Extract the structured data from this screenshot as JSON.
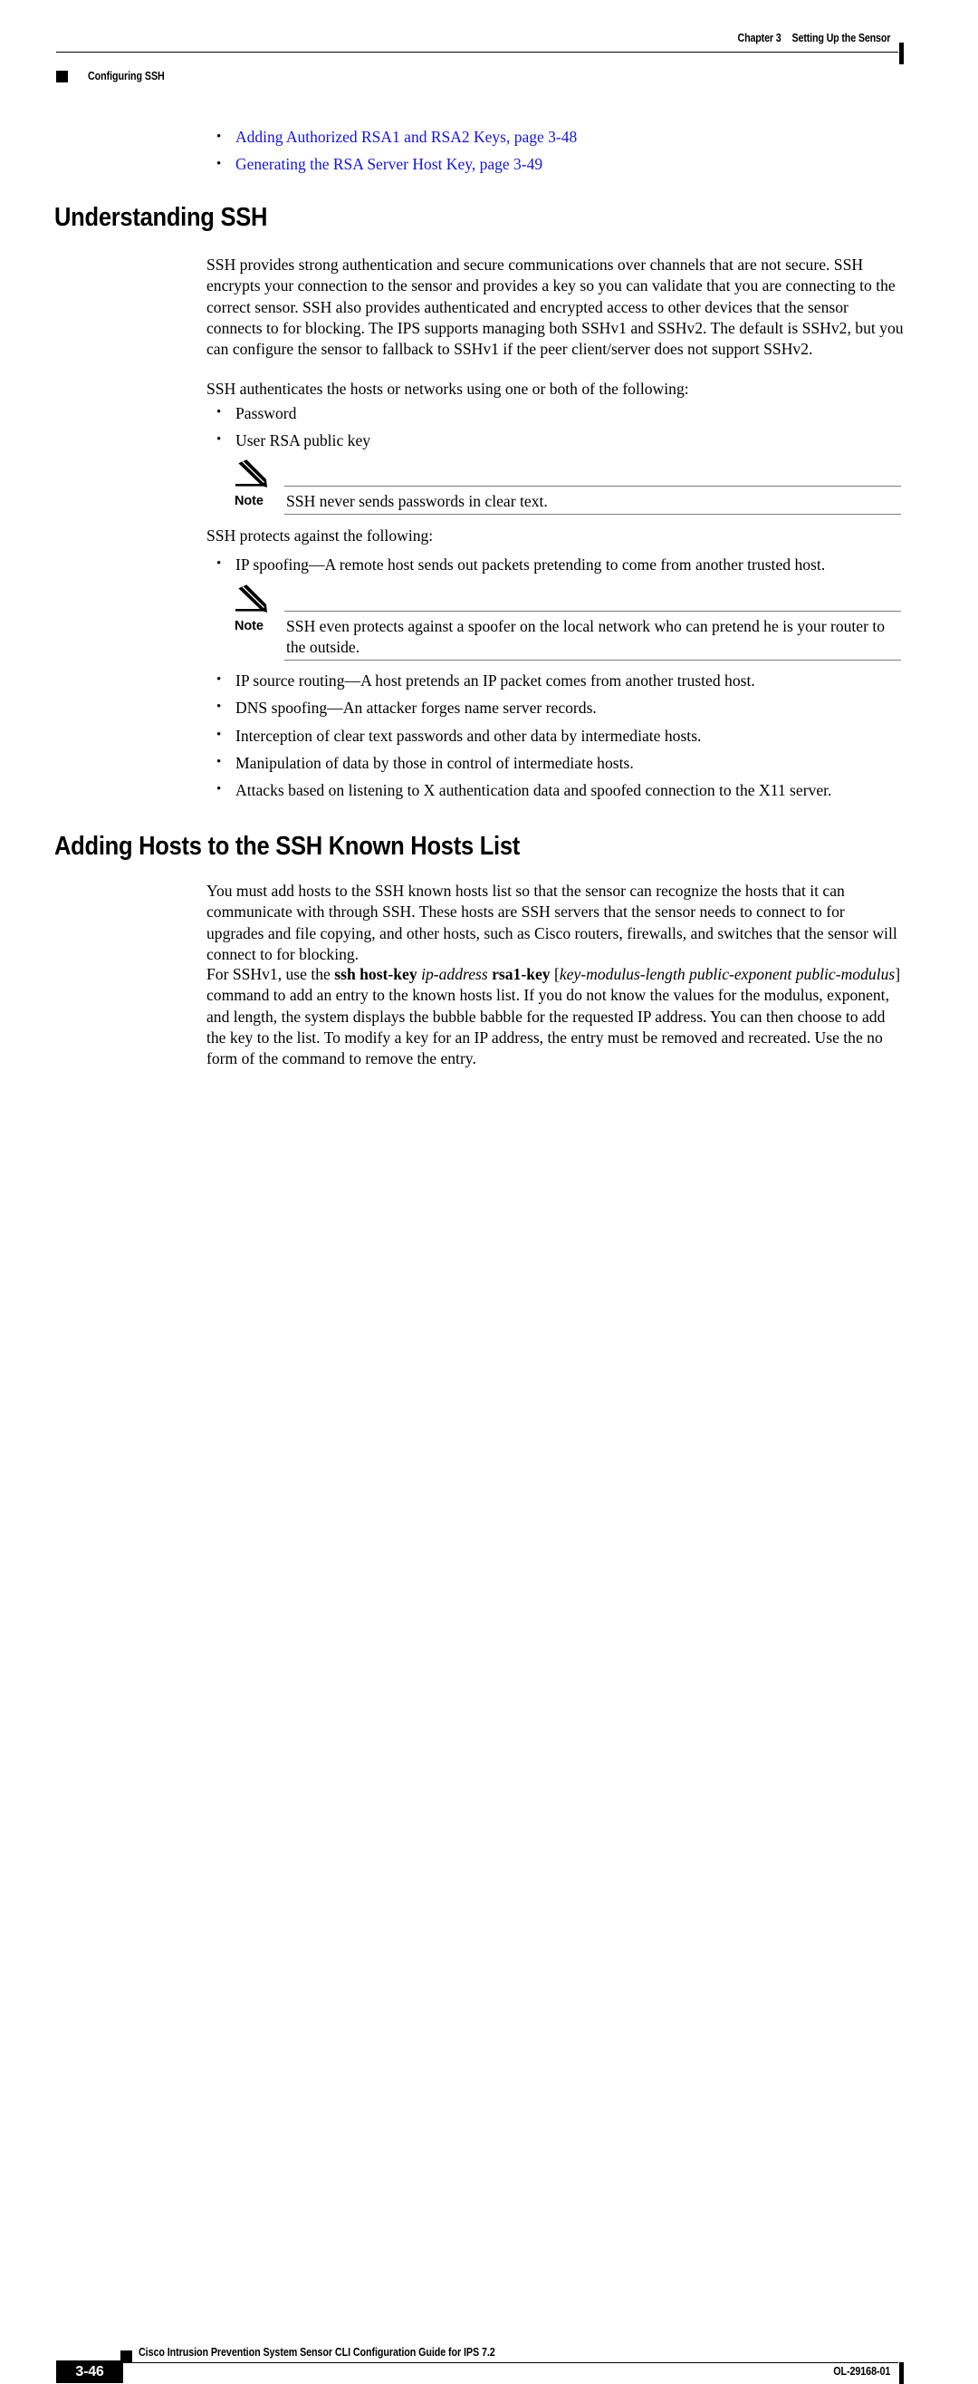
{
  "header": {
    "chapter_label": "Chapter 3",
    "chapter_title": "Setting Up the Sensor",
    "running_head": "Configuring SSH"
  },
  "crossrefs": [
    {
      "bullet": "•",
      "text": "Adding Authorized RSA1 and RSA2 Keys, page 3-48"
    },
    {
      "bullet": "•",
      "text": "Generating the RSA Server Host Key, page 3-49"
    }
  ],
  "sections": {
    "understanding_ssh": {
      "title": "Understanding SSH",
      "paragraph_1": "SSH provides strong authentication and secure communications over channels that are not secure. SSH encrypts your connection to the sensor and provides a key so you can validate that you are connecting to the correct sensor. SSH also provides authenticated and encrypted access to other devices that the sensor connects to for blocking. The IPS supports managing both SSHv1 and SSHv2. The default is SSHv2, but you can configure the sensor to fallback to SSHv1 if the peer client/server does not support SSHv2.",
      "paragraph_2": "SSH authenticates the hosts or networks using one or both of the following:",
      "auth_methods": [
        {
          "bullet": "•",
          "text": "Password"
        },
        {
          "bullet": "•",
          "text": "User RSA public key"
        }
      ],
      "note_1": {
        "icon": "pencil-note-icon",
        "label": "Note",
        "text": "SSH never sends passwords in clear text."
      },
      "paragraph_3": "SSH protects against the following:",
      "protects_first": [
        {
          "bullet": "•",
          "text": "IP spoofing—A remote host sends out packets pretending to come from another trusted host."
        }
      ],
      "note_2": {
        "icon": "pencil-note-icon",
        "label": "Note",
        "text": "SSH even protects against a spoofer on the local network who can pretend he is your router to the outside."
      },
      "protects_rest": [
        {
          "bullet": "•",
          "text": "IP source routing—A host pretends an IP packet comes from another trusted host."
        },
        {
          "bullet": "•",
          "text": "DNS spoofing—An attacker forges name server records."
        },
        {
          "bullet": "•",
          "text": "Interception of clear text passwords and other data by intermediate hosts."
        },
        {
          "bullet": "•",
          "text": "Manipulation of data by those in control of intermediate hosts."
        },
        {
          "bullet": "•",
          "text": "Attacks based on listening to X authentication data and spoofed connection to the X11 server."
        }
      ]
    },
    "adding_hosts": {
      "title": "Adding Hosts to the SSH Known Hosts List",
      "paragraph_1": "You must add hosts to the SSH known hosts list so that the sensor can recognize the hosts that it can communicate with through SSH. These hosts are SSH servers that the sensor needs to connect to for upgrades and file copying, and other hosts, such as Cisco routers, firewalls, and switches that the sensor will connect to for blocking.",
      "paragraph_2_parts": {
        "lead": "For SSHv1, use the ",
        "cmd_1": "ssh host-key",
        "arg_1": " ip-address ",
        "cmd_2": "rsa1-key",
        "bracket_open": " [",
        "arg_2": "key-modulus-length public-exponent public-modulus",
        "bracket_close": "]",
        "tail": " command to add an entry to the known hosts list. If you do not know the values for the modulus, exponent, and length, the system displays the bubble babble for the requested IP address. You can then choose to add the key to the list. To modify a key for an IP address, the entry must be removed and recreated. Use the no form of the command to remove the entry."
      }
    }
  },
  "footer": {
    "book_title": "Cisco Intrusion Prevention System Sensor CLI Configuration Guide for IPS 7.2",
    "page_number": "3-46",
    "doc_id": "OL-29168-01"
  },
  "colors": {
    "link_blue": "#1414e6",
    "text_black": "#000000",
    "rule_gray": "#7d7d7d"
  }
}
